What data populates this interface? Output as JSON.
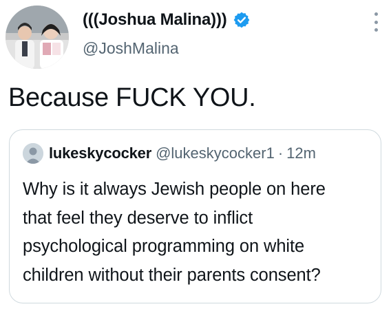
{
  "author": {
    "display_name": "(((Joshua Malina)))",
    "handle": "@JoshMalina",
    "verified": true,
    "avatar_icon": "profile-photo",
    "verified_icon": "verified-badge-icon"
  },
  "menu_icon": "more-options-icon",
  "tweet": {
    "text": "Because FUCK YOU."
  },
  "quoted_tweet": {
    "display_name": "lukeskycocker",
    "handle": "@lukeskycocker1",
    "separator": "·",
    "time": "12m",
    "avatar_icon": "default-avatar-icon",
    "text_lines": [
      "Why is it always Jewish people on here",
      "that feel they deserve to inflict",
      "psychological programming on white",
      "children without their parents consent?"
    ]
  },
  "colors": {
    "text": "#0f1419",
    "secondary_text": "#536471",
    "verified_blue": "#1d9bf0",
    "border": "#cfd9de"
  }
}
